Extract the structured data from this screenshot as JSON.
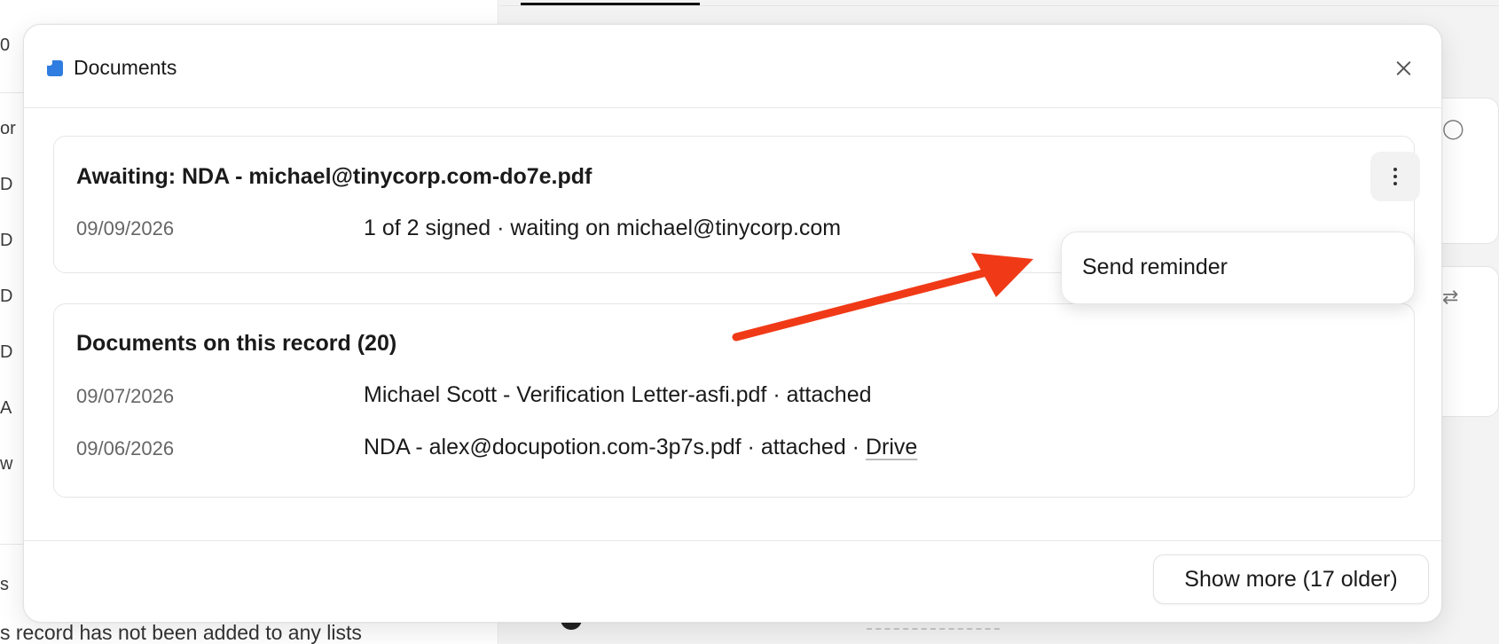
{
  "background": {
    "left_letters": [
      "0",
      "or",
      "D",
      "D",
      "D",
      "D",
      "A",
      "w",
      "s"
    ],
    "left_footer": "s record has not been added to any lists"
  },
  "modal": {
    "title": "Documents",
    "awaiting": {
      "title": "Awaiting: NDA - michael@tinycorp.com-do7e.pdf",
      "date": "09/09/2026",
      "status": "1 of 2 signed · waiting on michael@tinycorp.com"
    },
    "menu": {
      "send_reminder": "Send reminder"
    },
    "documents": {
      "title": "Documents on this record (20)",
      "rows": [
        {
          "date": "09/07/2026",
          "text": "Michael Scott - Verification Letter-asfi.pdf · attached",
          "link": ""
        },
        {
          "date": "09/06/2026",
          "text": "NDA - alex@docupotion.com-3p7s.pdf · attached · ",
          "link": "Drive"
        }
      ]
    },
    "show_more_label": "Show more (17 older)"
  },
  "colors": {
    "doc_icon": "#2f7de1",
    "annotation_arrow": "#f03a17"
  }
}
